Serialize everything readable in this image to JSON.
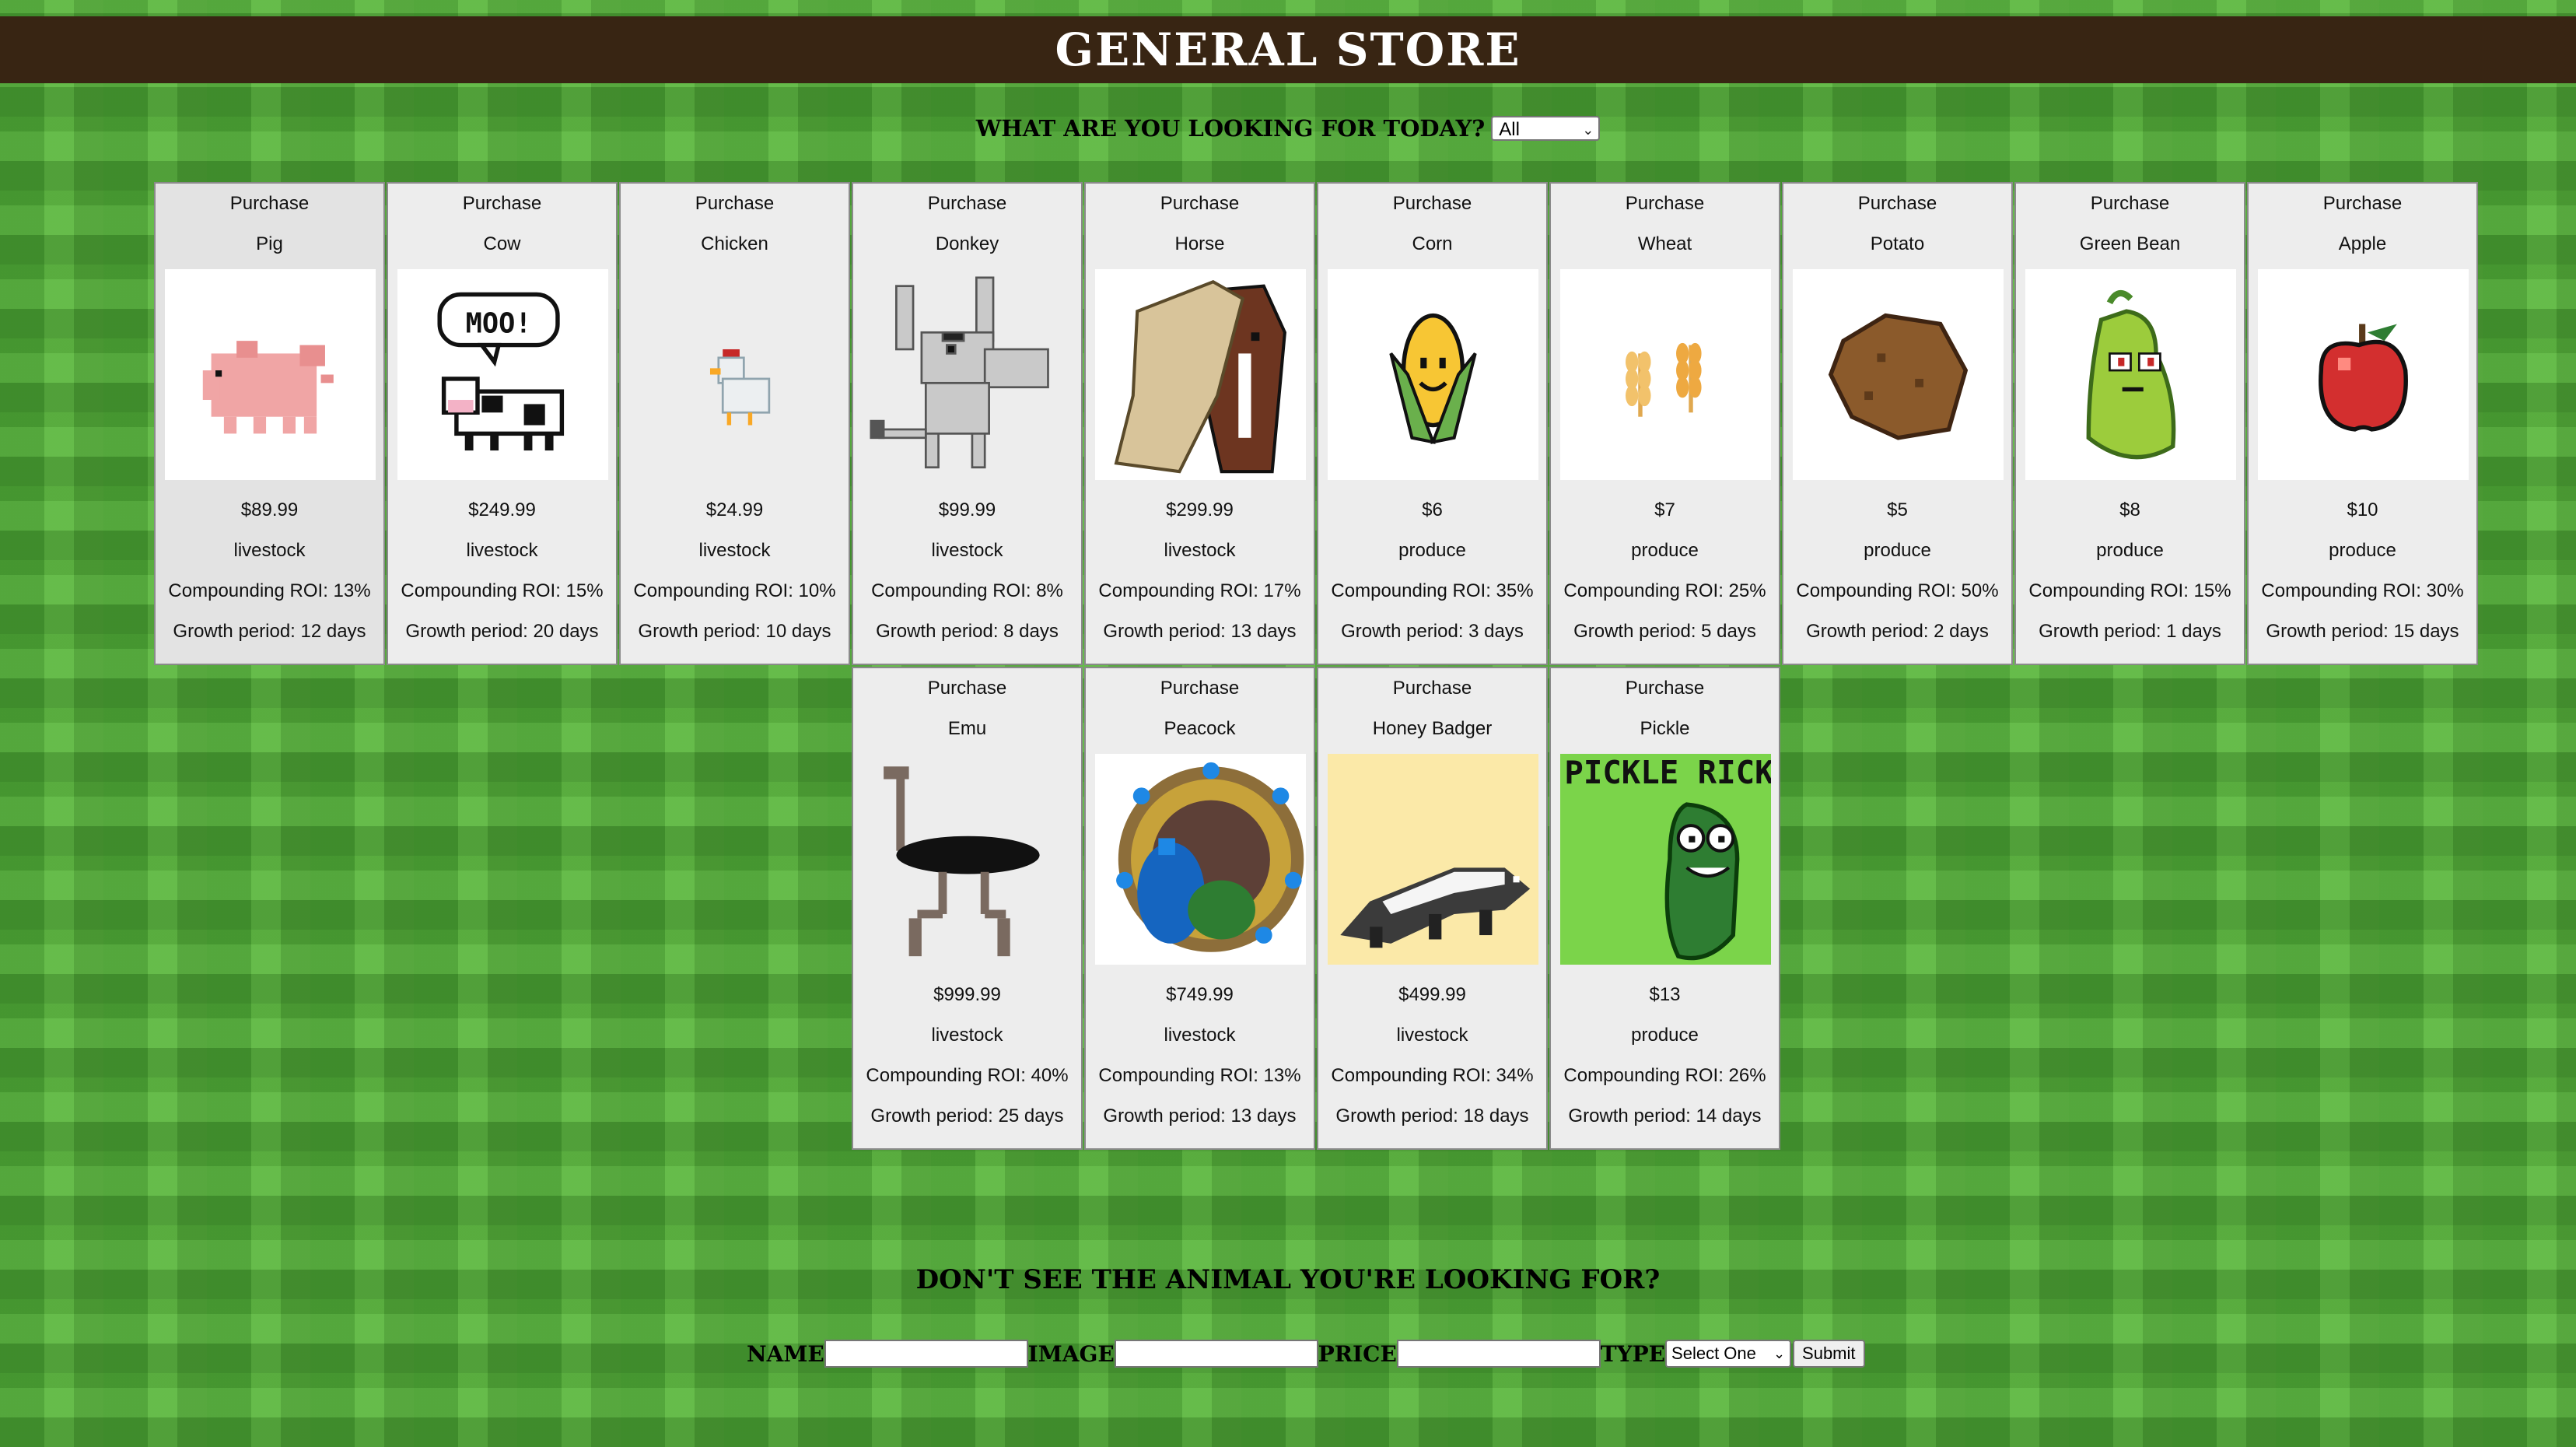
{
  "header": {
    "title": "GENERAL STORE"
  },
  "filter": {
    "label": "What are you looking for today?",
    "selected": "All"
  },
  "products": [
    {
      "purchase": "Purchase",
      "name": "Pig",
      "price": "$89.99",
      "type": "livestock",
      "roi": "Compounding ROI: 13%",
      "growth": "Growth period: 12 days",
      "icon": "pig-icon"
    },
    {
      "purchase": "Purchase",
      "name": "Cow",
      "price": "$249.99",
      "type": "livestock",
      "roi": "Compounding ROI: 15%",
      "growth": "Growth period: 20 days",
      "icon": "cow-icon",
      "speech": "MOO!"
    },
    {
      "purchase": "Purchase",
      "name": "Chicken",
      "price": "$24.99",
      "type": "livestock",
      "roi": "Compounding ROI: 10%",
      "growth": "Growth period: 10 days",
      "icon": "chicken-icon"
    },
    {
      "purchase": "Purchase",
      "name": "Donkey",
      "price": "$99.99",
      "type": "livestock",
      "roi": "Compounding ROI: 8%",
      "growth": "Growth period: 8 days",
      "icon": "donkey-icon"
    },
    {
      "purchase": "Purchase",
      "name": "Horse",
      "price": "$299.99",
      "type": "livestock",
      "roi": "Compounding ROI: 17%",
      "growth": "Growth period: 13 days",
      "icon": "horse-icon"
    },
    {
      "purchase": "Purchase",
      "name": "Corn",
      "price": "$6",
      "type": "produce",
      "roi": "Compounding ROI: 35%",
      "growth": "Growth period: 3 days",
      "icon": "corn-icon"
    },
    {
      "purchase": "Purchase",
      "name": "Wheat",
      "price": "$7",
      "type": "produce",
      "roi": "Compounding ROI: 25%",
      "growth": "Growth period: 5 days",
      "icon": "wheat-icon"
    },
    {
      "purchase": "Purchase",
      "name": "Potato",
      "price": "$5",
      "type": "produce",
      "roi": "Compounding ROI: 50%",
      "growth": "Growth period: 2 days",
      "icon": "potato-icon"
    },
    {
      "purchase": "Purchase",
      "name": "Green Bean",
      "price": "$8",
      "type": "produce",
      "roi": "Compounding ROI: 15%",
      "growth": "Growth period: 1 days",
      "icon": "green-bean-icon"
    },
    {
      "purchase": "Purchase",
      "name": "Apple",
      "price": "$10",
      "type": "produce",
      "roi": "Compounding ROI: 30%",
      "growth": "Growth period: 15 days",
      "icon": "apple-icon"
    },
    {
      "purchase": "Purchase",
      "name": "Emu",
      "price": "$999.99",
      "type": "livestock",
      "roi": "Compounding ROI: 40%",
      "growth": "Growth period: 25 days",
      "icon": "emu-icon"
    },
    {
      "purchase": "Purchase",
      "name": "Peacock",
      "price": "$749.99",
      "type": "livestock",
      "roi": "Compounding ROI: 13%",
      "growth": "Growth period: 13 days",
      "icon": "peacock-icon"
    },
    {
      "purchase": "Purchase",
      "name": "Honey Badger",
      "price": "$499.99",
      "type": "livestock",
      "roi": "Compounding ROI: 34%",
      "growth": "Growth period: 18 days",
      "icon": "honey-badger-icon"
    },
    {
      "purchase": "Purchase",
      "name": "Pickle",
      "price": "$13",
      "type": "produce",
      "roi": "Compounding ROI: 26%",
      "growth": "Growth period: 14 days",
      "icon": "pickle-icon",
      "art_text": "PICKLE RICK"
    }
  ],
  "add_form": {
    "title": "Don't see the animal you're looking for?",
    "name_label": "Name",
    "image_label": "Image",
    "price_label": "Price",
    "type_label": "Type",
    "name_value": "",
    "image_value": "",
    "price_value": "",
    "type_selected": "Select One",
    "submit_label": "Submit"
  }
}
